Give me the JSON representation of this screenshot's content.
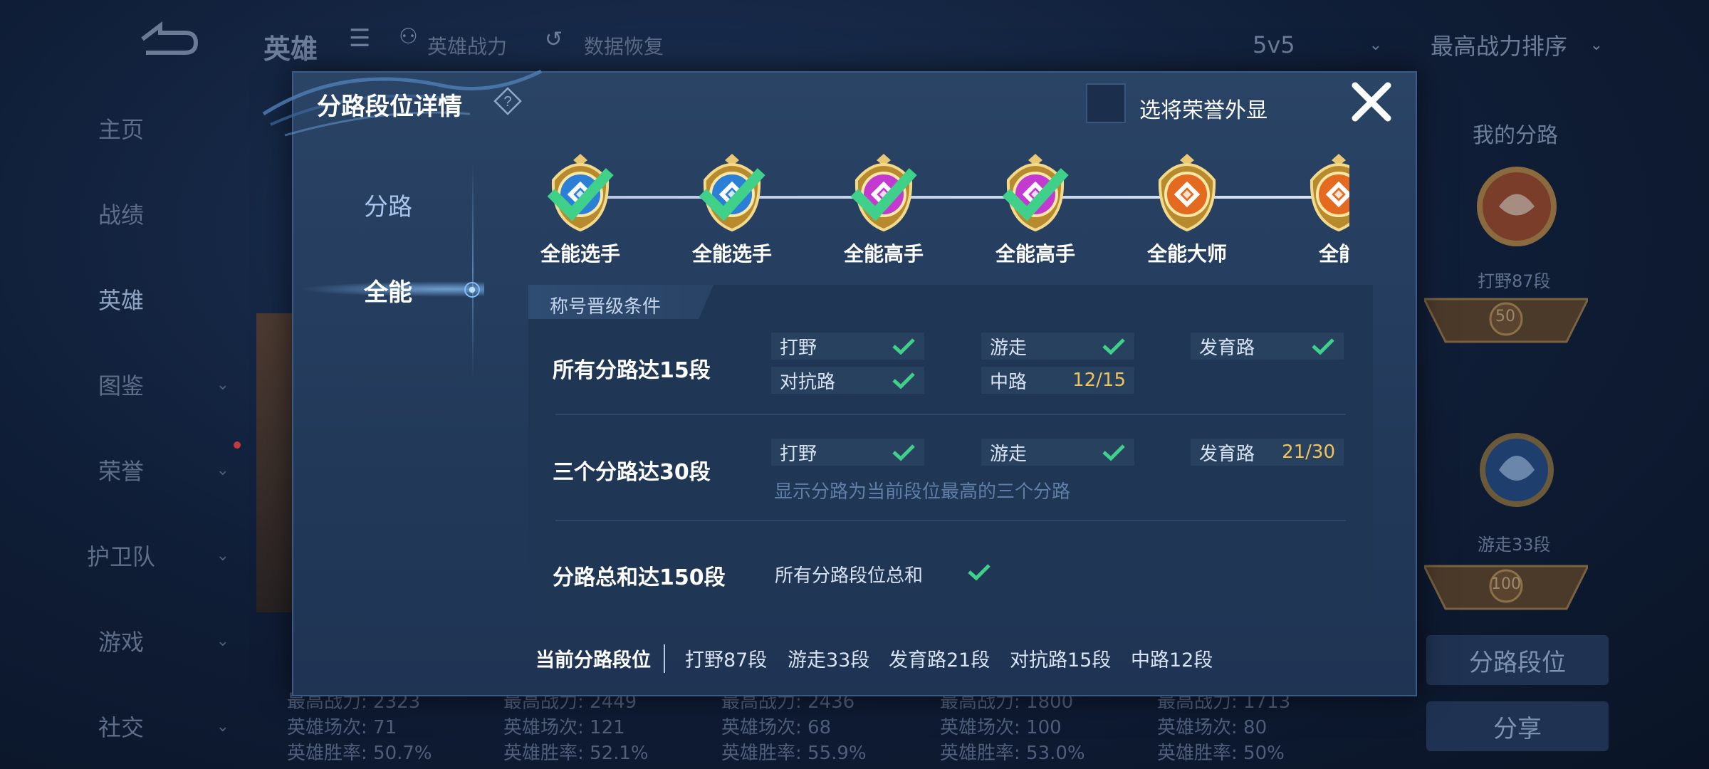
{
  "background": {
    "header": {
      "title": "英雄",
      "hero_power_label": "英雄战力",
      "data_restore_label": "数据恢复",
      "mode_value": "5v5",
      "sort_value": "最高战力排序"
    },
    "nav": [
      {
        "label": "主页"
      },
      {
        "label": "战绩"
      },
      {
        "label": "英雄"
      },
      {
        "label": "图鉴"
      },
      {
        "label": "荣誉"
      },
      {
        "label": "护卫队"
      },
      {
        "label": "游戏"
      },
      {
        "label": "社交"
      }
    ],
    "hero_cards": [
      {
        "power": "最高战力: 2323",
        "matches": "英雄场次: 71",
        "winrate": "英雄胜率: 50.7%"
      },
      {
        "power": "最高战力: 2449",
        "matches": "英雄场次: 121",
        "winrate": "英雄胜率: 52.1%"
      },
      {
        "power": "最高战力: 2436",
        "matches": "英雄场次: 68",
        "winrate": "英雄胜率: 55.9%"
      },
      {
        "power": "最高战力: 1800",
        "matches": "英雄场次: 100",
        "winrate": "英雄胜率: 53.0%"
      },
      {
        "power": "最高战力: 1713",
        "matches": "英雄场次: 80",
        "winrate": "英雄胜率: 50%"
      }
    ],
    "right_panel": {
      "title": "我的分路",
      "lane1_label": "打野87段",
      "lane1_badge": "50",
      "lane2_label": "游走33段",
      "lane2_badge": "100",
      "lane_rank_button": "分路段位",
      "share_button": "分享"
    }
  },
  "modal": {
    "title": "分路段位详情",
    "honor_checkbox_label": "选将荣誉外显",
    "tabs": [
      {
        "label": "分路"
      },
      {
        "label": "全能"
      }
    ],
    "ranks": [
      {
        "label": "全能选手",
        "tier": "blue",
        "achieved": true
      },
      {
        "label": "全能选手",
        "tier": "blue",
        "achieved": true
      },
      {
        "label": "全能高手",
        "tier": "purple",
        "achieved": true
      },
      {
        "label": "全能高手",
        "tier": "purple",
        "achieved": true
      },
      {
        "label": "全能大师",
        "tier": "orange",
        "achieved": false
      },
      {
        "label": "全能",
        "tier": "orange",
        "achieved": false
      }
    ],
    "conditions_tab_label": "称号晋级条件",
    "conditions": {
      "row1": {
        "title": "所有分路达15段",
        "items": [
          {
            "name": "打野",
            "status": "done"
          },
          {
            "name": "游走",
            "status": "done"
          },
          {
            "name": "发育路",
            "status": "done"
          },
          {
            "name": "对抗路",
            "status": "done"
          },
          {
            "name": "中路",
            "value": "12/15"
          }
        ]
      },
      "row2": {
        "title": "三个分路达30段",
        "items": [
          {
            "name": "打野",
            "status": "done"
          },
          {
            "name": "游走",
            "status": "done"
          },
          {
            "name": "发育路",
            "value": "21/30"
          }
        ],
        "note": "显示分路为当前段位最高的三个分路"
      },
      "row3": {
        "title": "分路总和达150段",
        "desc": "所有分路段位总和",
        "status": "done"
      }
    },
    "current": {
      "label": "当前分路段位",
      "items": [
        "打野87段",
        "游走33段",
        "发育路21段",
        "对抗路15段",
        "中路12段"
      ]
    }
  },
  "colors": {
    "check": "#3fd08a",
    "progress": "#f1c25b",
    "modal_bg": "#253e60",
    "blue_tier": "#2c7fd6",
    "purple_tier": "#c33ad0",
    "orange_tier": "#e36a1e"
  }
}
